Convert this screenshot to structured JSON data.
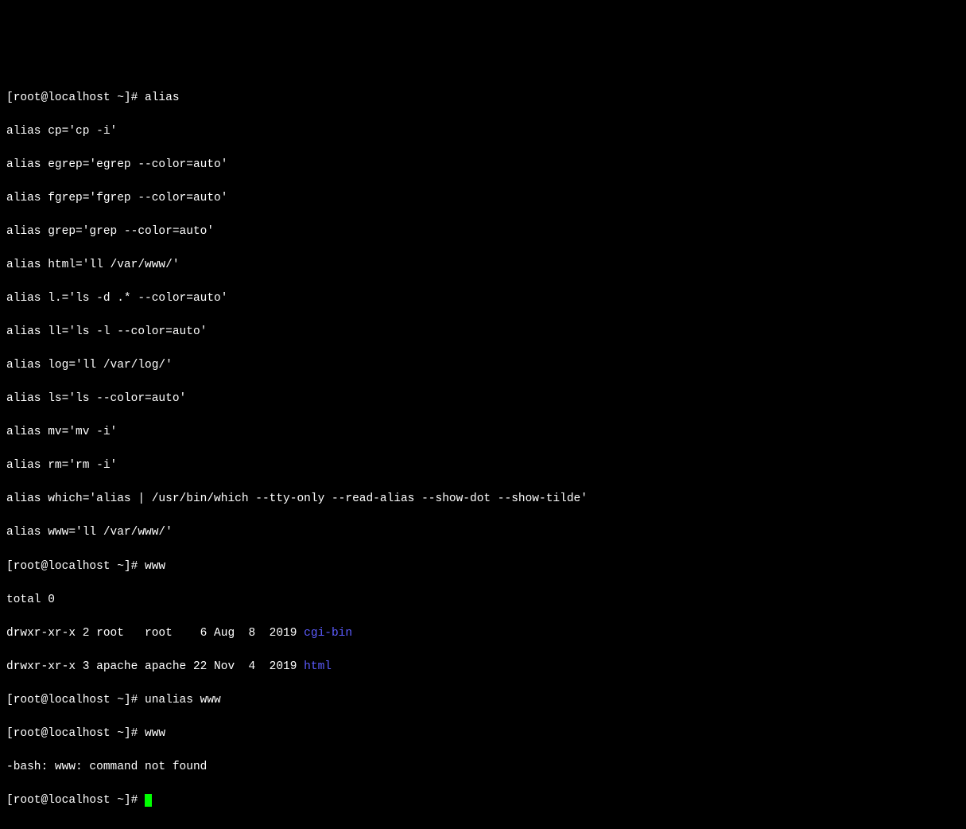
{
  "prompt": "[root@localhost ~]# ",
  "commands": {
    "alias": "alias",
    "www": "www",
    "unalias_www": "unalias www"
  },
  "alias_output": [
    "alias cp='cp -i'",
    "alias egrep='egrep --color=auto'",
    "alias fgrep='fgrep --color=auto'",
    "alias grep='grep --color=auto'",
    "alias html='ll /var/www/'",
    "alias l.='ls -d .* --color=auto'",
    "alias ll='ls -l --color=auto'",
    "alias log='ll /var/log/'",
    "alias ls='ls --color=auto'",
    "alias mv='mv -i'",
    "alias rm='rm -i'",
    "alias which='alias | /usr/bin/which --tty-only --read-alias --show-dot --show-tilde'",
    "alias www='ll /var/www/'"
  ],
  "ll_output": {
    "total": "total 0",
    "rows": [
      {
        "meta": "drwxr-xr-x 2 root   root    6 Aug  8  2019 ",
        "name": "cgi-bin"
      },
      {
        "meta": "drwxr-xr-x 3 apache apache 22 Nov  4  2019 ",
        "name": "html"
      }
    ]
  },
  "error": "-bash: www: command not found"
}
